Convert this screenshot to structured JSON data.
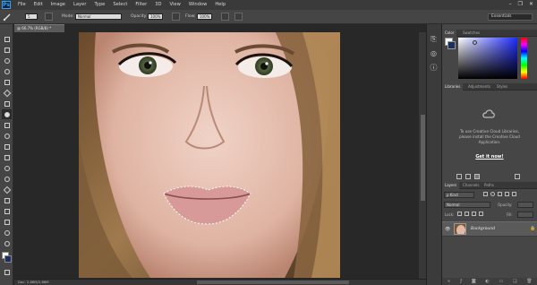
{
  "app": {
    "logo": "Ps"
  },
  "menus": [
    "File",
    "Edit",
    "Image",
    "Layer",
    "Type",
    "Select",
    "Filter",
    "3D",
    "View",
    "Window",
    "Help"
  ],
  "window_controls": {
    "minimize": "–",
    "restore": "❐",
    "close": "✕"
  },
  "options_bar": {
    "brush_size": "5",
    "mode_label": "Mode:",
    "mode_value": "Normal",
    "opacity_label": "Opacity:",
    "opacity_value": "100%",
    "flow_label": "Flow:",
    "flow_value": "100%",
    "workspace": "Essentials"
  },
  "document": {
    "tab_label": "@ 66.7% (RGB/8) *",
    "status": "Doc: 2.86M/2.86M"
  },
  "panels": {
    "color_tabs": [
      "Color",
      "Swatches"
    ],
    "libraries_tabs": [
      "Libraries",
      "Adjustments",
      "Styles"
    ],
    "libraries_text_1": "To use Creative Cloud Libraries,",
    "libraries_text_2": "please install the Creative Cloud",
    "libraries_text_3": "Application.",
    "libraries_cta": "Get it now!",
    "layers_tabs": [
      "Layers",
      "Channels",
      "Paths"
    ],
    "kind_label": "ρ Kind",
    "blend_mode": "Normal",
    "opacity_label": "Opacity:",
    "lock_label": "Lock:",
    "fill_label": "Fill:",
    "layer_name": "Background"
  },
  "icons": {
    "eye": "visibility-eye-icon",
    "lock": "lock-icon",
    "libraries": "creative-cloud-icon"
  },
  "colors": {
    "accent": "#2fa3f6",
    "foreground": "#ffffff",
    "background": "#1c3060"
  }
}
